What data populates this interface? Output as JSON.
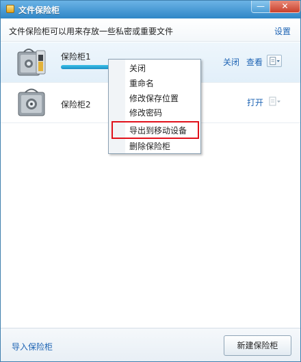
{
  "window": {
    "title": "文件保险柜",
    "minimize_label": "—",
    "close_label": "✕"
  },
  "header": {
    "description": "文件保险柜可以用来存放一些私密或重要文件",
    "settings_label": "设置"
  },
  "vaults": [
    {
      "name": "保险柜1",
      "close_label": "关闭",
      "view_label": "查看",
      "progress": 0.55,
      "icon": "vault-open-icon"
    },
    {
      "name": "保险柜2",
      "open_label": "打开",
      "icon": "vault-locked-icon"
    }
  ],
  "context_menu": {
    "items": [
      "关闭",
      "重命名",
      "修改保存位置",
      "修改密码",
      "导出到移动设备",
      "删除保险柜"
    ],
    "highlighted": "导出到移动设备",
    "highlight_color": "#e0101a"
  },
  "footer": {
    "import_label": "导入保险柜",
    "new_label": "新建保险柜"
  },
  "colors": {
    "titlebar": "#2f86c6",
    "link": "#1e64b4"
  }
}
